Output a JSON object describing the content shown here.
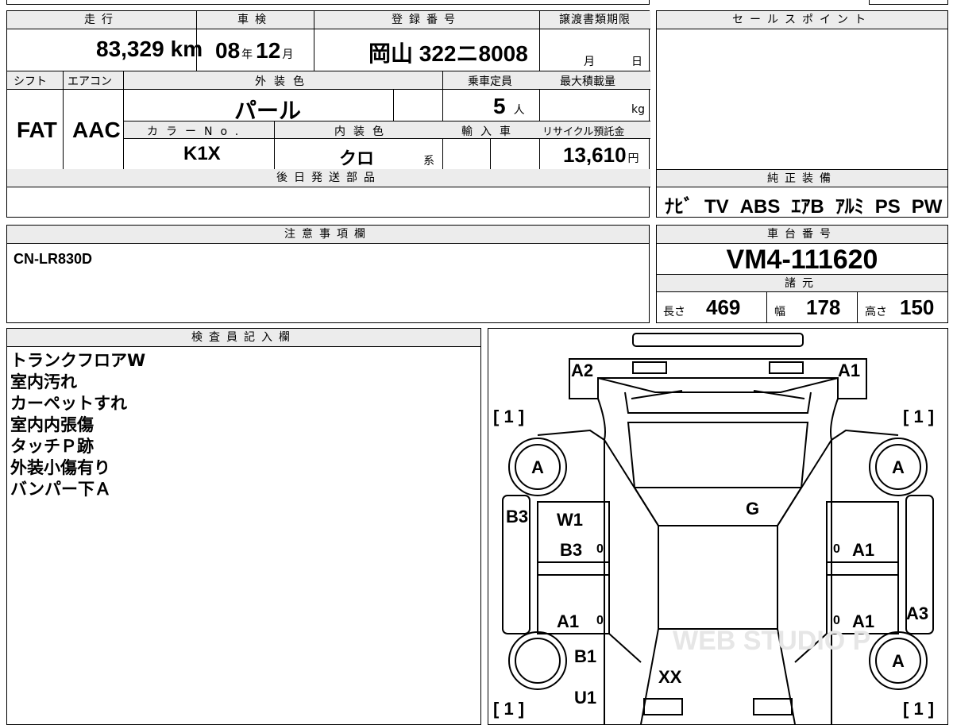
{
  "header": {
    "mileage_label": "走行",
    "inspection_label": "車検",
    "registration_label": "登録番号",
    "transfer_deadline_label": "譲渡書類期限",
    "sales_point_label": "セールスポイント"
  },
  "values": {
    "mileage": "83,329",
    "mileage_unit": "km",
    "inspection_year": "08",
    "year_unit": "年",
    "inspection_month": "12",
    "month_unit": "月",
    "registration_number": "岡山 322ニ8008",
    "transfer_month_unit": "月",
    "transfer_day_unit": "日"
  },
  "row2": {
    "shift_label": "シフト",
    "aircon_label": "エアコン",
    "exterior_color_label": "外装色",
    "capacity_label": "乗車定員",
    "max_load_label": "最大積載量",
    "shift": "FAT",
    "aircon": "AAC",
    "exterior_color": "パール",
    "capacity": "5",
    "capacity_unit": "人",
    "max_load_unit": "kg"
  },
  "row3": {
    "color_no_label": "カラーNo.",
    "interior_color_label": "内装色",
    "import_label": "輸入車",
    "recycle_label": "リサイクル預託金",
    "color_no": "K1X",
    "interior_color": "クロ",
    "interior_suffix": "系",
    "recycle_fee": "13,610",
    "recycle_unit": "円"
  },
  "later_parts_label": "後日発送部品",
  "genuine_equipment_label": "純正装備",
  "genuine_equipment": [
    "ﾅﾋﾞ",
    "TV",
    "ABS",
    "ｴｱB",
    "ｱﾙﾐ",
    "PS",
    "PW"
  ],
  "notes_label": "注意事項欄",
  "notes_value": "CN-LR830D",
  "chassis_label": "車台番号",
  "chassis_number": "VM4-111620",
  "specs_label": "諸元",
  "specs": {
    "length_label": "長さ",
    "length": "469",
    "width_label": "幅",
    "width": "178",
    "height_label": "高さ",
    "height": "150"
  },
  "inspector_label": "検査員記入欄",
  "inspector_notes": [
    "トランクフロアW",
    "室内汚れ",
    "カーペットすれ",
    "室内内張傷",
    "タッチＰ跡",
    "外装小傷有り",
    "バンパー下Ａ"
  ],
  "diagram": {
    "A2": "A2",
    "A1_top": "A1",
    "bracket_tl": "[ 1 ]",
    "bracket_tr": "[ 1 ]",
    "bracket_bl": "[ 1 ]",
    "bracket_br": "[ 1 ]",
    "tire_fl": "A",
    "tire_fr": "A",
    "tire_rr": "A",
    "B3_left": "B3",
    "W1": "W1",
    "B3_door": "B3",
    "G": "G",
    "A1_right_front": "A1",
    "A1_left_rear": "A1",
    "A1_right_rear": "A1",
    "A3": "A3",
    "B1": "B1",
    "XX": "XX",
    "U1": "U1",
    "zero": "0",
    "watermark": "WEB STUDIO P"
  }
}
